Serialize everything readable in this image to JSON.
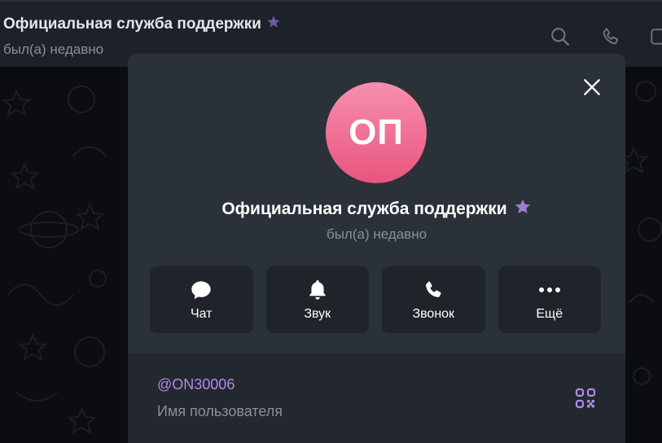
{
  "header": {
    "title": "Официальная служба поддержки",
    "status": "был(а) недавно",
    "icons": [
      "search-icon",
      "phone-icon",
      "sidebar-icon"
    ]
  },
  "profile": {
    "avatar_initials": "ОП",
    "avatar_color": "#ec6a8f",
    "name": "Официальная служба поддержки",
    "status": "был(а) недавно",
    "star_color": "#9b7fd6"
  },
  "actions": [
    {
      "label": "Чат",
      "icon": "chat-bubble-icon"
    },
    {
      "label": "Звук",
      "icon": "bell-icon"
    },
    {
      "label": "Звонок",
      "icon": "phone-icon"
    },
    {
      "label": "Ещё",
      "icon": "more-dots-icon"
    }
  ],
  "info": {
    "username": "@ON30006",
    "username_caption": "Имя пользователя"
  },
  "colors": {
    "accent": "#b18be6",
    "modal_bg": "#2b3139",
    "button_bg": "#1f242b"
  }
}
